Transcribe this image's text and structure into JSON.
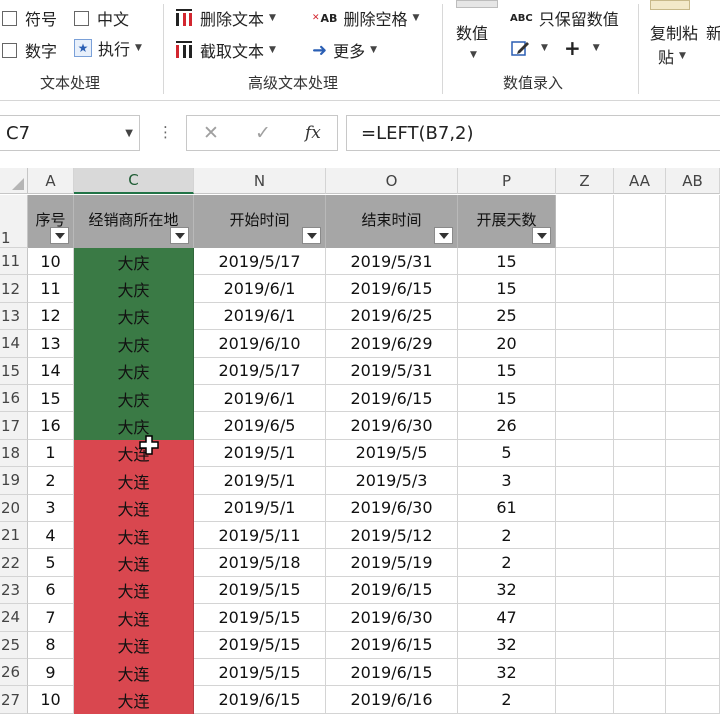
{
  "ribbon": {
    "groups": [
      {
        "label": "文本处理"
      },
      {
        "label": "高级文本处理"
      },
      {
        "label": "数值录入"
      }
    ],
    "text_processing": {
      "symbol": "符号",
      "chinese": "中文",
      "digits": "数字",
      "execute": "执行"
    },
    "advanced": {
      "delete_text": "删除文本",
      "truncate_text": "截取文本",
      "delete_spaces": "删除空格",
      "more": "更多",
      "abc_label": "AB"
    },
    "numeric": {
      "value": "数值",
      "keep_numeric": "只保留数值",
      "abc_label": "ABC",
      "plus": "+"
    },
    "clipboard": {
      "copy_paste_top": "复制粘",
      "copy_paste_bottom": "贴",
      "new_partial": "新"
    }
  },
  "formula_bar": {
    "name_box": "C7",
    "formula": "=LEFT(B7,2)",
    "dots": "⋮",
    "cancel": "✕",
    "confirm": "✓",
    "fx": "fx"
  },
  "columns": [
    "A",
    "C",
    "N",
    "O",
    "P",
    "Z",
    "AA",
    "AB"
  ],
  "header_row": {
    "row_number": "1",
    "cells": [
      "序号",
      "经销商所在地",
      "开始时间",
      "结束时间",
      "开展天数"
    ]
  },
  "rows": [
    {
      "num": "11",
      "seq": "10",
      "city": "大庆",
      "start": "2019/5/17",
      "end": "2019/5/31",
      "days": "15"
    },
    {
      "num": "12",
      "seq": "11",
      "city": "大庆",
      "start": "2019/6/1",
      "end": "2019/6/15",
      "days": "15"
    },
    {
      "num": "13",
      "seq": "12",
      "city": "大庆",
      "start": "2019/6/1",
      "end": "2019/6/25",
      "days": "25"
    },
    {
      "num": "14",
      "seq": "13",
      "city": "大庆",
      "start": "2019/6/10",
      "end": "2019/6/29",
      "days": "20"
    },
    {
      "num": "15",
      "seq": "14",
      "city": "大庆",
      "start": "2019/5/17",
      "end": "2019/5/31",
      "days": "15"
    },
    {
      "num": "16",
      "seq": "15",
      "city": "大庆",
      "start": "2019/6/1",
      "end": "2019/6/15",
      "days": "15"
    },
    {
      "num": "17",
      "seq": "16",
      "city": "大庆",
      "start": "2019/6/5",
      "end": "2019/6/30",
      "days": "26"
    },
    {
      "num": "18",
      "seq": "1",
      "city": "大连",
      "start": "2019/5/1",
      "end": "2019/5/5",
      "days": "5"
    },
    {
      "num": "19",
      "seq": "2",
      "city": "大连",
      "start": "2019/5/1",
      "end": "2019/5/3",
      "days": "3"
    },
    {
      "num": "20",
      "seq": "3",
      "city": "大连",
      "start": "2019/5/1",
      "end": "2019/6/30",
      "days": "61"
    },
    {
      "num": "21",
      "seq": "4",
      "city": "大连",
      "start": "2019/5/11",
      "end": "2019/5/12",
      "days": "2"
    },
    {
      "num": "22",
      "seq": "5",
      "city": "大连",
      "start": "2019/5/18",
      "end": "2019/5/19",
      "days": "2"
    },
    {
      "num": "23",
      "seq": "6",
      "city": "大连",
      "start": "2019/5/15",
      "end": "2019/6/15",
      "days": "32"
    },
    {
      "num": "24",
      "seq": "7",
      "city": "大连",
      "start": "2019/5/15",
      "end": "2019/6/30",
      "days": "47"
    },
    {
      "num": "25",
      "seq": "8",
      "city": "大连",
      "start": "2019/5/15",
      "end": "2019/6/15",
      "days": "32"
    },
    {
      "num": "26",
      "seq": "9",
      "city": "大连",
      "start": "2019/5/15",
      "end": "2019/6/15",
      "days": "32"
    },
    {
      "num": "27",
      "seq": "10",
      "city": "大连",
      "start": "2019/6/15",
      "end": "2019/6/16",
      "days": "2"
    }
  ],
  "colors": {
    "daqing_fill": "#3a7a45",
    "dalian_fill": "#d9474f",
    "header_fill": "#a6a6a6",
    "selected_col": "#217346"
  }
}
